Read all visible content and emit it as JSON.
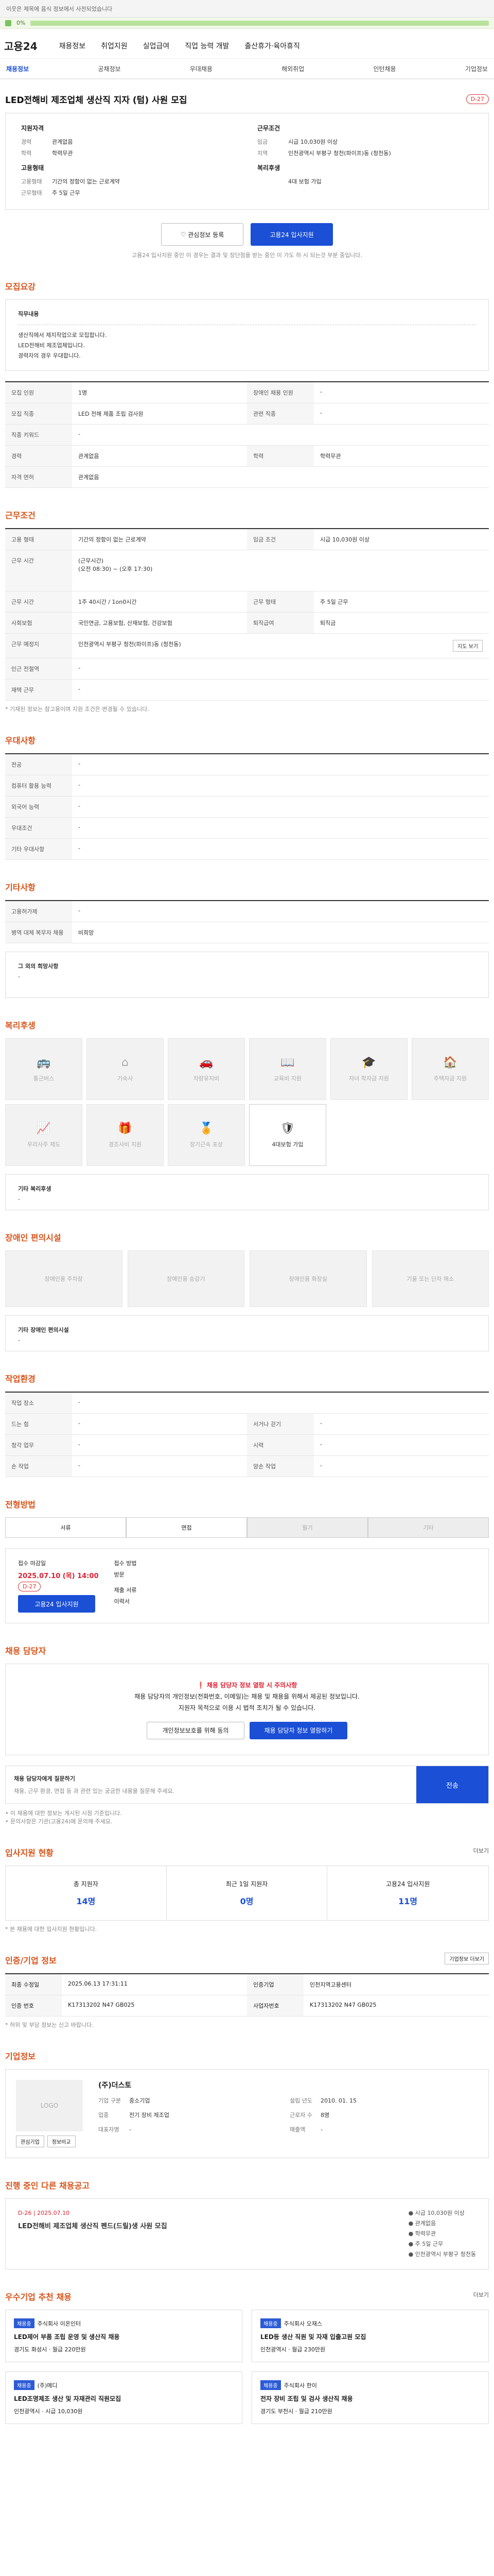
{
  "top": {
    "notice": "이웃은 제목에 음식 정보에서 사전되었습니다",
    "pct": "0%"
  },
  "gnb": {
    "logo": "고용24",
    "items": [
      "채용정보",
      "취업지원",
      "실업급여",
      "직업 능력 개발",
      "출산휴가·육아휴직"
    ]
  },
  "subnav": [
    "채용정보",
    "공채정보",
    "우대채용",
    "해외취업",
    "인턴채용",
    "기업정보"
  ],
  "job": {
    "title": "LED전해비 제조업체 생산직 지자 (텀) 사원 모집",
    "badge": "D-27",
    "company_heading": "지원자격",
    "company_rows": [
      {
        "k": "경력",
        "v": "관계없음"
      },
      {
        "k": "학력",
        "v": "학력무관"
      }
    ],
    "cond_heading": "근무조건",
    "cond_rows": [
      {
        "k": "임금",
        "v": "시급 10,030원 이상"
      },
      {
        "k": "지역",
        "v": "인천광역시 부평구 청천(파이프)동 (청천동)"
      }
    ],
    "emp_heading": "고용형태",
    "emp_rows": [
      {
        "k": "고용형태",
        "v": "기간의 정함이 없는 근로계약"
      },
      {
        "k": "근무형태",
        "v": "주 5일 근무"
      }
    ],
    "wf_heading": "복리후생",
    "wf_rows": [
      {
        "k": "",
        "v": "4대 보험 가입"
      }
    ],
    "btn_interest": "관심정보 등록",
    "btn_apply": "고용24 입사지원",
    "apply_note": "고용24 입사지원 중인 이 경우는 결과 및 장단점을 받는 중인 이 가도 하 시 되는것 부분 중입니다."
  },
  "sections": {
    "summary": {
      "title": "모집요강",
      "box_head": "직무내용",
      "box_lines": [
        "생산직에서 제지작업으로 모집합니다.",
        "LED전해비 제조업체입니다.",
        "경력자의 경우 우대합니다."
      ],
      "rows": [
        {
          "k": "모집 인원",
          "v": "1명",
          "k2": "장애인 채용 인원",
          "v2": "-"
        },
        {
          "k": "모집 직종",
          "v": "LED 전해 제품 조립 검사원",
          "k2": "관련 직종",
          "v2": "-"
        },
        {
          "k": "직종 키워드",
          "v": "-",
          "k2": "",
          "v2": ""
        },
        {
          "k": "경력",
          "v": "관계없음",
          "k2": "학력",
          "v2": "학력무관"
        },
        {
          "k": "자격 면허",
          "v": "관계없음",
          "k2": "",
          "v2": ""
        }
      ]
    },
    "work": {
      "title": "근무조건",
      "rows": [
        {
          "k": "고용 형태",
          "v": "기간의 정함이 없는 근로계약",
          "k2": "임금 조건",
          "v2": "시급 10,030원 이상"
        },
        {
          "k": "근무 시간",
          "v": "(근무시간)\n(오전 08:30) ~ (오후 17:30)",
          "k2": "",
          "v2": ""
        },
        {
          "k": "근무 시간",
          "v": "1주 40시간 / 1on0시간",
          "k2": "근무 형태",
          "v2": "주 5일 근무"
        },
        {
          "k": "사회보험",
          "v": "국민연금, 고용보험, 산재보험, 건강보험",
          "k2": "퇴직급여",
          "v2": "퇴직금"
        },
        {
          "k": "근무 예정지",
          "v": "인천광역시 부평구 청천(파이프)동 (청천동)",
          "k2": "",
          "v2": ""
        },
        {
          "k": "인근 전철역",
          "v": "-",
          "k2": "",
          "v2": ""
        },
        {
          "k": "재택 근무",
          "v": "-",
          "k2": "",
          "v2": ""
        }
      ],
      "map_btn": "지도 보기",
      "footnote": "* 기재된 정보는 참고용이며 지원 조건은 변경될 수 있습니다."
    },
    "pref": {
      "title": "우대사항",
      "rows": [
        {
          "k": "전공",
          "v": "-"
        },
        {
          "k": "컴퓨터 활용 능력",
          "v": "-"
        },
        {
          "k": "외국어 능력",
          "v": "-"
        },
        {
          "k": "우대조건",
          "v": "-"
        },
        {
          "k": "기타 우대사항",
          "v": "-"
        }
      ]
    },
    "etc": {
      "title": "기타사항",
      "rows": [
        {
          "k": "고용허가제",
          "v": "-"
        },
        {
          "k": "병역 대체 복무자 채용",
          "v": "비희망"
        }
      ],
      "box_head": "그 외의 희망사항",
      "box_body": "-"
    },
    "welfare": {
      "title": "복리후생",
      "tiles": [
        "통근버스",
        "기숙사",
        "차량유지비",
        "교육비 지원",
        "자녀 학자금 지원",
        "주택자금 지원",
        "우리사주 제도",
        "경조사비 지원",
        "장기근속 포상",
        "4대보험 가입"
      ],
      "box_head": "기타 복리후생",
      "box_body": "-"
    },
    "disabled": {
      "title": "장애인 편의시설",
      "tiles": [
        "장애인용 주차장",
        "장애인용 승강기",
        "장애인용 화장실",
        "기울 또는 단차 해소"
      ],
      "box_head": "기타 장애인 편의시설",
      "box_body": "-"
    },
    "workplace": {
      "title": "작업환경",
      "rows": [
        {
          "k": "작업 장소",
          "v": "-",
          "k2": "",
          "v2": ""
        },
        {
          "k": "드는 힘",
          "v": "-",
          "k2": "서거나 걷기",
          "v2": "-"
        },
        {
          "k": "청각 업무",
          "v": "-",
          "k2": "시력",
          "v2": "-"
        },
        {
          "k": "손 작업",
          "v": "-",
          "k2": "양손 작업",
          "v2": "-"
        }
      ]
    },
    "process": {
      "title": "전형방법",
      "tabs": [
        "서류",
        "면접",
        "필기",
        "기타"
      ],
      "apply_head": "접수 마감일",
      "deadline": "2025.07.10 (목) 14:00",
      "dday": "D-27",
      "method_head": "접수 방법",
      "method": "방문",
      "docs_head": "제출 서류",
      "docs": "이력서",
      "btn_apply": "고용24 입사지원"
    },
    "contact": {
      "title": "채용 담당자",
      "alert": "채용 담당자 정보 열람 시 주의사항",
      "lines": [
        "채용 담당자의 개인정보(전화번호, 이메일)는 채용 및 채용을 위해서 제공된 정보입니다.",
        "지원자 목적으로 이용 시 법적 조치가 될 수 있습니다."
      ],
      "btn_check": "개인정보보호를 위해 동의",
      "btn_view": "채용 담당자 정보 열람하기",
      "ask_title": "채용 담당자에게 질문하기",
      "ask_hint": "채용, 근무 환경, 면접 등 과 관련 있는 궁금한 내용을 질문해 주세요.",
      "ask_btn": "전송",
      "notes": [
        "• 이 채용에 대한 정보는 게시된 시점 기준입니다.",
        "• 문의사항은 기관(고용24)에 문의해 주세요."
      ]
    },
    "stats": {
      "title": "입사지원 현황",
      "more": "더보기",
      "items": [
        {
          "label": "총 지원자",
          "num": "14명"
        },
        {
          "label": "최근 1일 지원자",
          "num": "0명"
        },
        {
          "label": "고용24 입사지원",
          "num": "11명"
        }
      ],
      "note": "* 본 채용에 대한 입사지원 현황입니다."
    },
    "info": {
      "title": "인증/기업 정보",
      "btn": "기업정보 더보기",
      "rows": [
        {
          "k": "최종 수정일",
          "v": "2025.06.13 17:31:11",
          "k2": "인증기업",
          "v2": "인천지역고용센터"
        },
        {
          "k": "인증 번호",
          "v": "K17313202 N47 GB025",
          "k2": "사업자번호",
          "v2": "K17313202 N47 GB025"
        }
      ],
      "note": "* 허위 및 부당 정보는 신고 바랍니다."
    },
    "company": {
      "title": "기업정보",
      "name": "(주)더스토",
      "rows": [
        {
          "k": "기업 구분",
          "v": "중소기업"
        },
        {
          "k": "업종",
          "v": "전기 장비 제조업"
        },
        {
          "k": "대표자명",
          "v": "-"
        },
        {
          "k": "근로자 수",
          "v": "8명"
        },
        {
          "k": "설립 년도",
          "v": "2010. 01. 15"
        },
        {
          "k": "매출액",
          "v": "-"
        }
      ],
      "btn_fav": "관심기업",
      "btn_compare": "정보비교"
    },
    "current": {
      "title": "진행 중인 다른 채용공고",
      "date": "D-26 | 2025.07.10",
      "job": "LED전해비 제조업체 생산직 펜드(드릴)생 사원 모집",
      "rows": [
        "● 시급 10,030원 이상",
        "● 관계없음",
        "● 학력무관",
        "● 주 5일 근무",
        "● 인천광역시 부평구 청천동"
      ]
    },
    "similar": {
      "title": "우수기업 추천 채용",
      "more": "더보기",
      "cards": [
        {
          "tag": "채용중",
          "co": "주식회사 이온인터",
          "job": "LED제어 부품 조립 운영 및 생산직 채용",
          "loc": "경기도 화성시",
          "pay": "월급 220만원"
        },
        {
          "tag": "채용중",
          "co": "주식회사 오재스",
          "job": "LED등 생산 직원 및 자재 입출고원 모집",
          "loc": "인천광역시",
          "pay": "월급 230만원"
        },
        {
          "tag": "채용중",
          "co": "(주)메디",
          "job": "LED조명제조 생산 및 자재관리 직원모집",
          "loc": "인천광역시",
          "pay": "시급 10,030원"
        },
        {
          "tag": "채용중",
          "co": "주식회사 한이",
          "job": "전자 장비 조립 및 검사 생산직 채용",
          "loc": "경기도 부천시",
          "pay": "월급 210만원"
        }
      ]
    }
  }
}
